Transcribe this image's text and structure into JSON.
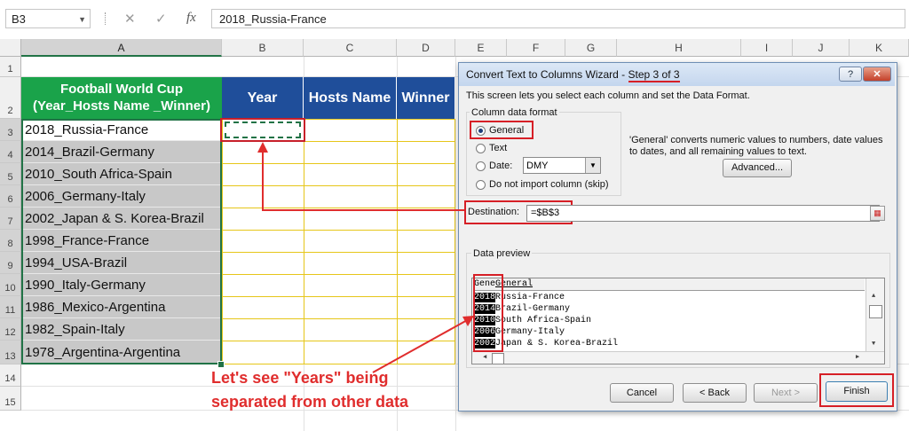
{
  "formula_bar": {
    "name_box": "B3",
    "cancel_icon": "✕",
    "enter_icon": "✓",
    "fx_icon": "fx",
    "formula": "2018_Russia-France"
  },
  "columns": [
    "A",
    "B",
    "C",
    "D",
    "E",
    "F",
    "G",
    "H",
    "I",
    "J",
    "K"
  ],
  "rows": [
    "1",
    "2",
    "3",
    "4",
    "5",
    "6",
    "7",
    "8",
    "9",
    "10",
    "11",
    "12",
    "13",
    "14",
    "15"
  ],
  "table": {
    "header_a": "Football World Cup (Year_Hosts Name _Winner)",
    "header_year": "Year",
    "header_hosts": "Hosts Name",
    "header_winner": "Winner",
    "values": [
      "2018_Russia-France",
      "2014_Brazil-Germany",
      "2010_South Africa-Spain",
      "2006_Germany-Italy",
      "2002_Japan & S. Korea-Brazil",
      "1998_France-France",
      "1994_USA-Brazil",
      "1990_Italy-Germany",
      "1986_Mexico-Argentina",
      "1982_Spain-Italy",
      "1978_Argentina-Argentina"
    ]
  },
  "annotation": {
    "line1": "Let's see \"Years\" being",
    "line2": "separated from other data"
  },
  "colors": {
    "header_green": "#1aa34a",
    "header_blue": "#1f4e9a",
    "annotation_red": "#e02d2d",
    "selection_green": "#217346"
  },
  "dialog": {
    "title": "Convert Text to Columns Wizard - ",
    "step": "Step 3 of 3",
    "help_label": "?",
    "close_label": "✕",
    "intro": "This screen lets you select each column and set the Data Format.",
    "format_group": "Column data format",
    "radio_general": "General",
    "radio_text": "Text",
    "radio_date": "Date:",
    "date_value": "DMY",
    "radio_skip": "Do not import column (skip)",
    "general_desc": "'General' converts numeric values to numbers, date values to dates, and all remaining values to text.",
    "advanced_label": "Advanced...",
    "destination_label": "Destination:",
    "destination_value": "=$B$3",
    "preview_label": "Data preview",
    "preview_header_1": "Gene",
    "preview_header_2": "General",
    "preview_years": [
      "2018",
      "2014",
      "2010",
      "2006",
      "2002"
    ],
    "preview_rest": [
      "Russia-France",
      "Brazil-Germany",
      "South Africa-Spain",
      "Germany-Italy",
      "Japan & S. Korea-Brazil"
    ],
    "cancel_label": "Cancel",
    "back_label": "< Back",
    "next_label": "Next >",
    "finish_label": "Finish"
  }
}
